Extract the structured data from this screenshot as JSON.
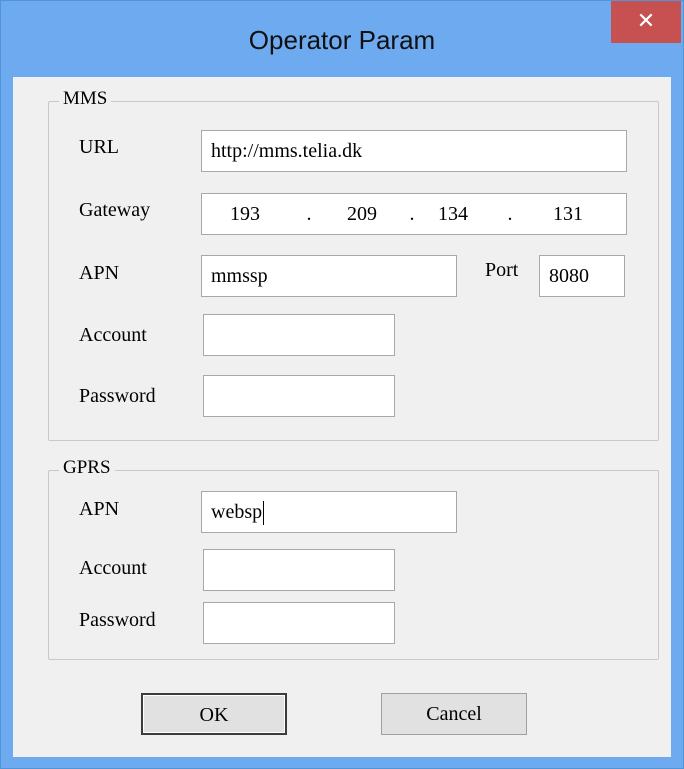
{
  "window": {
    "title": "Operator Param",
    "close_glyph": "✕"
  },
  "mms": {
    "group_label": "MMS",
    "url_label": "URL",
    "url_value": "http://mms.telia.dk",
    "gateway_label": "Gateway",
    "gateway": [
      "193",
      "209",
      "134",
      "131"
    ],
    "gateway_separator": ".",
    "apn_label": "APN",
    "apn_value": "mmssp",
    "port_label": "Port",
    "port_value": "8080",
    "account_label": "Account",
    "account_value": "",
    "password_label": "Password",
    "password_value": ""
  },
  "gprs": {
    "group_label": "GPRS",
    "apn_label": "APN",
    "apn_value": "websp",
    "account_label": "Account",
    "account_value": "",
    "password_label": "Password",
    "password_value": ""
  },
  "buttons": {
    "ok_label": "OK",
    "cancel_label": "Cancel"
  },
  "colors": {
    "titlebar": "#6eaaf0",
    "close_button": "#c75050",
    "dialog_background": "#f0f0f0"
  },
  "icons": {
    "close": "close-icon"
  }
}
